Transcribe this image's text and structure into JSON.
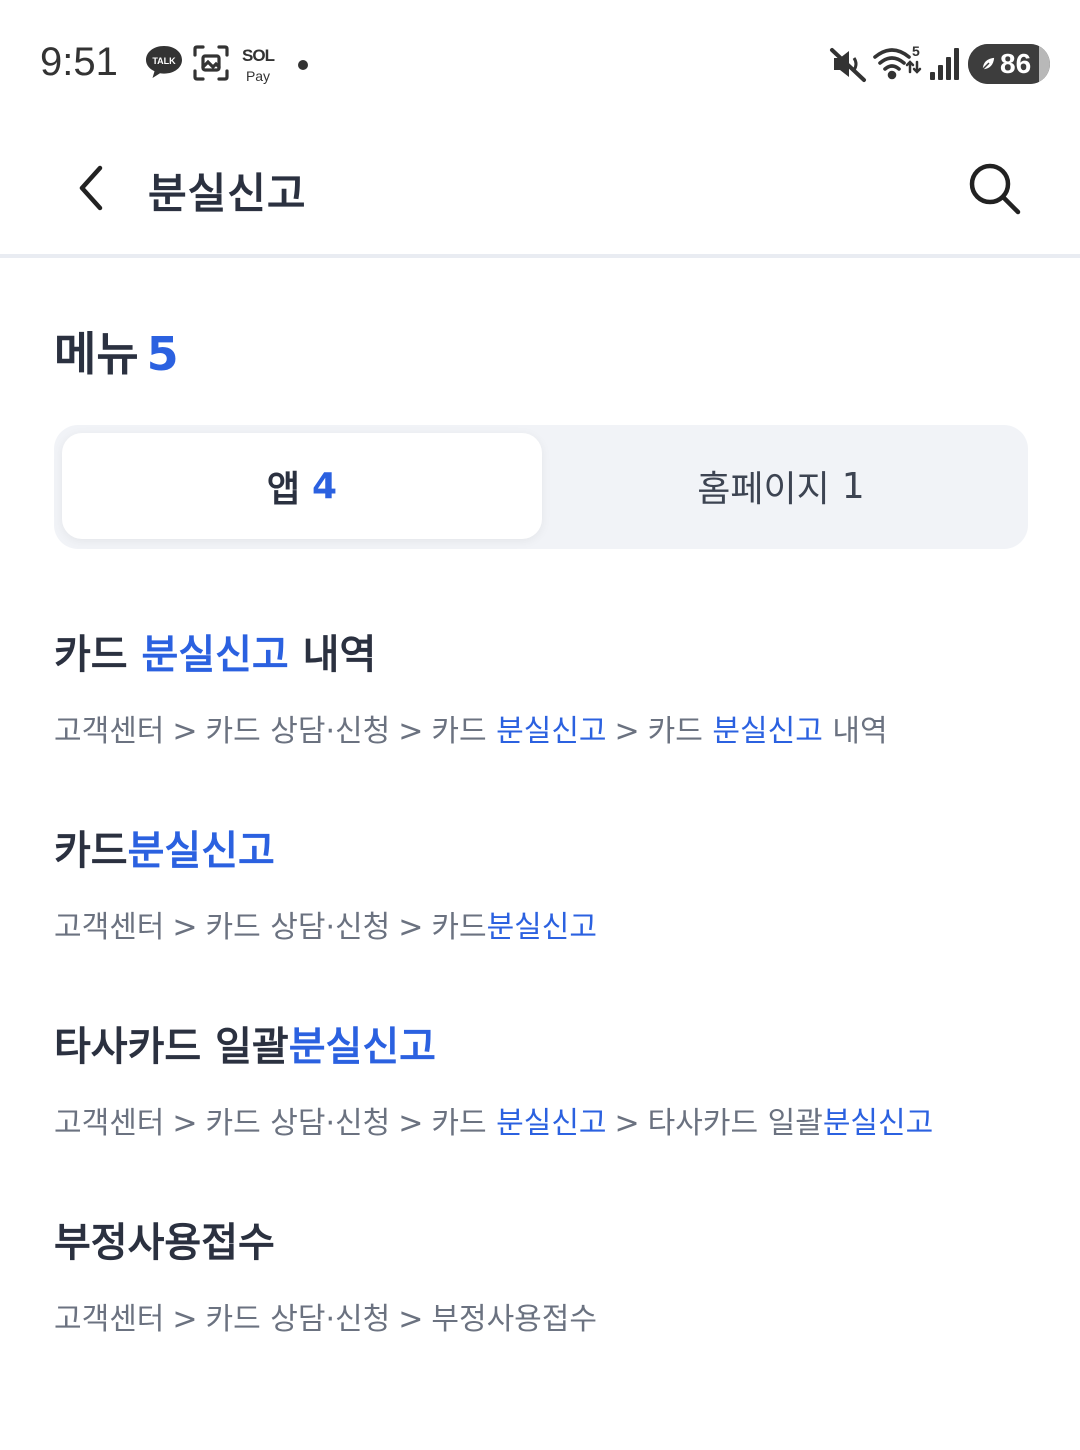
{
  "status_bar": {
    "time": "9:51",
    "talk_label": "TALK",
    "sol_label": "SOL",
    "pay_label": "Pay",
    "wifi_badge": "5",
    "battery": "86",
    "icons": [
      "kakaotalk-icon",
      "screenshot-icon",
      "sol-pay-icon",
      "notification-dot-icon",
      "mute-icon",
      "wifi-icon",
      "signal-icon",
      "battery-icon"
    ]
  },
  "header": {
    "title": "분실신고",
    "back_icon": "chevron-left-icon",
    "search_icon": "search-icon"
  },
  "menu": {
    "label": "메뉴",
    "count": "5"
  },
  "tabs": [
    {
      "label": "앱",
      "count": "4",
      "selected": true
    },
    {
      "label": "홈페이지",
      "count": "1",
      "selected": false
    }
  ],
  "results": [
    {
      "title": {
        "pre": "카드 ",
        "hl": "분실신고",
        "post": " 내역"
      },
      "path": [
        "고객센터",
        "카드 상담·신청",
        "카드 분실신고",
        "카드 분실신고 내역"
      ],
      "path_render": {
        "p1": "고객센터",
        "p2": "카드 상담·신청",
        "p3_pre": "카드 ",
        "p3_hl": "분실신고",
        "p4_pre": "카드 ",
        "p4_hl": "분실신고",
        "p4_post": " 내역"
      }
    },
    {
      "title": {
        "pre": "카드",
        "hl": "분실신고",
        "post": ""
      },
      "path": [
        "고객센터",
        "카드 상담·신청",
        "카드분실신고"
      ],
      "path_render": {
        "p1": "고객센터",
        "p2": "카드 상담·신청",
        "p3_pre": "카드",
        "p3_hl": "분실신고"
      }
    },
    {
      "title": {
        "pre": "타사카드 일괄",
        "hl": "분실신고",
        "post": ""
      },
      "path": [
        "고객센터",
        "카드 상담·신청",
        "카드 분실신고",
        "타사카드 일괄분실신고"
      ],
      "path_render": {
        "p1": "고객센터",
        "p2": "카드 상담·신청",
        "p3_pre": "카드 ",
        "p3_hl": "분실신고",
        "p4_pre": "타사카드 일괄",
        "p4_hl": "분실신고"
      }
    },
    {
      "title": {
        "pre": "부정사용접수",
        "hl": "",
        "post": ""
      },
      "path": [
        "고객센터",
        "카드 상담·신청",
        "부정사용접수"
      ],
      "path_render": {
        "p1": "고객센터",
        "p2": "카드 상담·신청",
        "p3_pre": "부정사용접수"
      }
    }
  ],
  "path_separator": ">",
  "colors": {
    "accent": "#2b61e0",
    "text": "#2b3140",
    "path_text": "#6b7280",
    "tab_bg": "#f1f3f7"
  }
}
